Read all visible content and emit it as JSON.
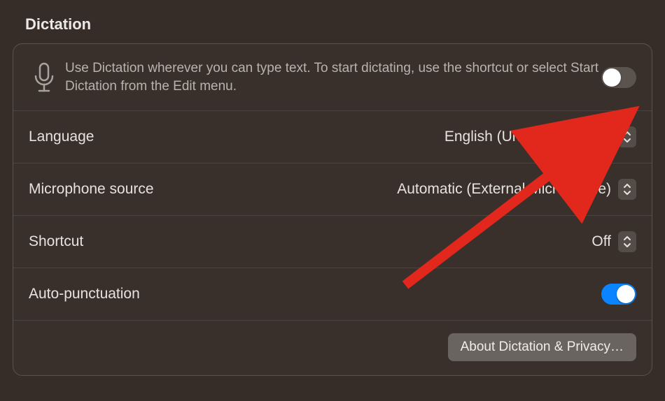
{
  "title": "Dictation",
  "intro": "Use Dictation wherever you can type text. To start dictating, use the shortcut or select Start Dictation from the Edit menu.",
  "dictation_toggle": {
    "on": false
  },
  "rows": {
    "language": {
      "label": "Language",
      "value": "English (United Kingdom)"
    },
    "mic": {
      "label": "Microphone source",
      "value": "Automatic (External Microphone)"
    },
    "shortcut": {
      "label": "Shortcut",
      "value": "Off"
    },
    "autopunct": {
      "label": "Auto-punctuation",
      "on": true
    }
  },
  "about_button": "About Dictation & Privacy…",
  "colors": {
    "accent": "#0a84ff",
    "annotation": "#e2271d"
  }
}
